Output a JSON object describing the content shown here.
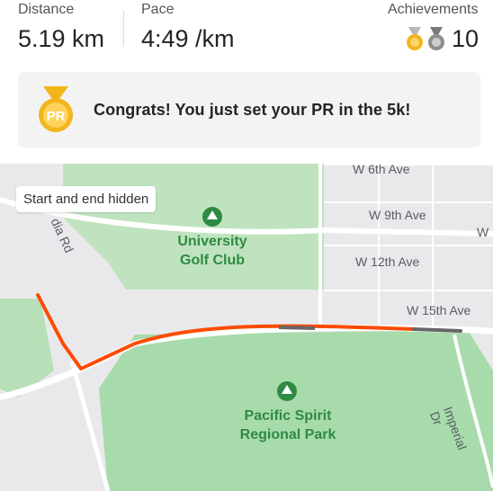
{
  "stats": {
    "distance_label": "Distance",
    "distance_value": "5.19 km",
    "pace_label": "Pace",
    "pace_value": "4:49 /km",
    "achievements_label": "Achievements",
    "achievements_count": "10",
    "medal_icons": [
      "gold-medal-icon",
      "silver-medal-icon"
    ]
  },
  "pr_banner": {
    "badge_text": "PR",
    "message": "Congrats! You just set your PR in the 5k!"
  },
  "map": {
    "chip": "Start and end hidden",
    "streets": [
      "W 6th Ave",
      "W 9th Ave",
      "W 12th Ave",
      "W 15th Ave",
      "Imperial Dr",
      "dia Rd",
      "W"
    ],
    "places": [
      {
        "line1": "University",
        "line2": "Golf Club"
      },
      {
        "line1": "Pacific Spirit",
        "line2": "Regional Park"
      }
    ],
    "colors": {
      "route": "#fc4c02",
      "park": "#a8dbab",
      "land": "#e9e9ec",
      "road": "#ffffff"
    }
  }
}
